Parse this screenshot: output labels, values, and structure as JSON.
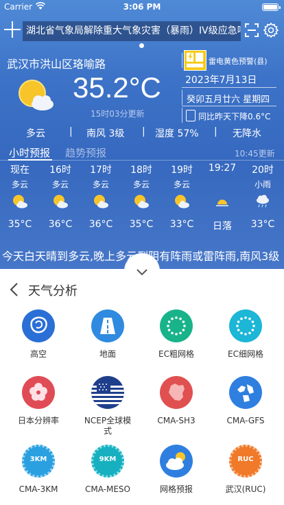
{
  "status_bar": {
    "carrier": "Carrier",
    "time": "3:06 PM"
  },
  "alert_banner": "湖北省气象局解除重大气象灾害（暴雨）IV级应急响应",
  "location": "武汉市洪山区珞喻路",
  "current": {
    "temperature": "35.2°C",
    "update_time": "15时03分更新",
    "condition": "多云",
    "wind": "南风 3级",
    "humidity": "湿度 57%",
    "precipitation": "无降水"
  },
  "warning": {
    "label": "雷电黄色预警(县)",
    "color": "#f6c911"
  },
  "date": "2023年7月13日",
  "lunar": "癸卯五月廿六 星期四",
  "compare": "同比昨天下降0.6°C",
  "tabs": {
    "hourly": "小时预报",
    "trend": "趋势预报"
  },
  "hourly_update": "10:45更新",
  "hourly": [
    {
      "hour": "现在",
      "cond": "多云",
      "icon": "partly-cloudy-icon",
      "temp": "35°C"
    },
    {
      "hour": "16时",
      "cond": "多云",
      "icon": "partly-cloudy-icon",
      "temp": "36°C"
    },
    {
      "hour": "17时",
      "cond": "多云",
      "icon": "partly-cloudy-icon",
      "temp": "36°C"
    },
    {
      "hour": "18时",
      "cond": "多云",
      "icon": "partly-cloudy-icon",
      "temp": "35°C"
    },
    {
      "hour": "19时",
      "cond": "多云",
      "icon": "partly-cloudy-icon",
      "temp": "33°C"
    },
    {
      "hour": "19:27",
      "cond": "",
      "icon": "sunset-icon",
      "temp": "日落"
    },
    {
      "hour": "20时",
      "cond": "小雨",
      "icon": "light-rain-icon",
      "temp": "33°C"
    }
  ],
  "ticker": "今天白天晴到多云,晚上多云到阴有阵雨或雷阵雨,南风3级",
  "analysis": {
    "title": "天气分析",
    "items": [
      {
        "label": "高空",
        "icon": "upper-air-icon",
        "color": "#2a6fd6"
      },
      {
        "label": "地面",
        "icon": "road-icon",
        "color": "#2f8ae0"
      },
      {
        "label": "EC粗网格",
        "icon": "eu-flag-icon",
        "color": "#19b38a"
      },
      {
        "label": "EC细网格",
        "icon": "eu-flag-icon",
        "color": "#1cb6d6"
      },
      {
        "label": "日本分辨率",
        "icon": "japan-icon",
        "color": "#e04c56"
      },
      {
        "label": "NCEP全球模式",
        "icon": "us-flag-icon",
        "color": "#1f3f8c"
      },
      {
        "label": "CMA-SH3",
        "icon": "china-map-icon",
        "color": "#e05050"
      },
      {
        "label": "CMA-GFS",
        "icon": "globe-icon",
        "color": "#2f7fe0"
      },
      {
        "label": "CMA-3KM",
        "icon": "badge-3km-icon",
        "badge": "3KM",
        "color": "#2aa0e0"
      },
      {
        "label": "CMA-MESO",
        "icon": "badge-9km-icon",
        "badge": "9KM",
        "color": "#17b0c0"
      },
      {
        "label": "网格预报",
        "icon": "cloud-grid-icon",
        "color": "#2f7fe0"
      },
      {
        "label": "武汉(RUC)",
        "icon": "badge-ruc-icon",
        "badge": "RUC",
        "color": "#f07a2a"
      }
    ]
  }
}
